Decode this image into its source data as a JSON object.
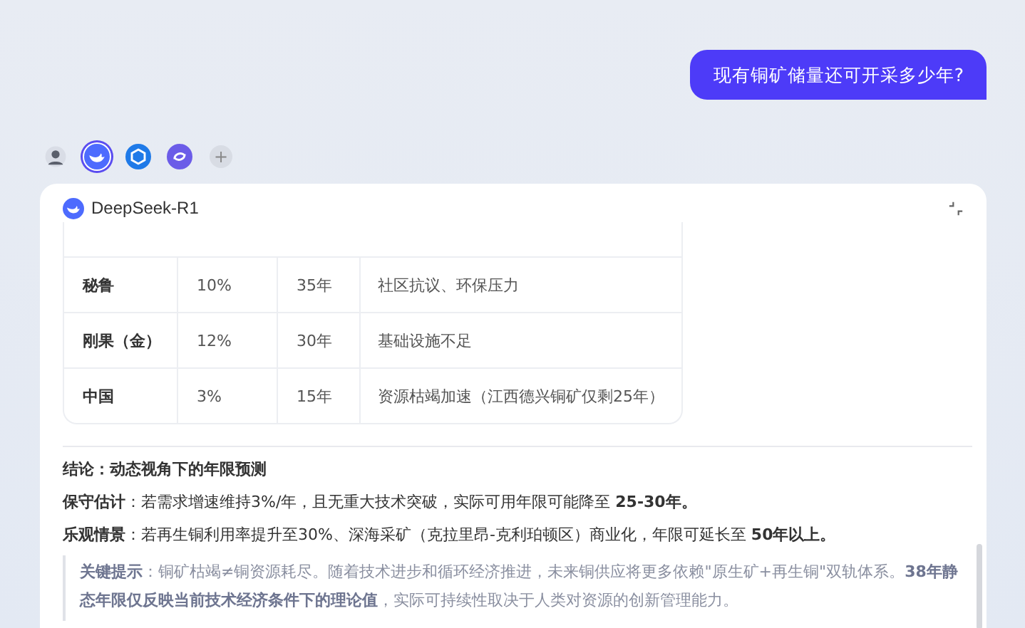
{
  "user_message": "现有铜矿储量还可开采多少年?",
  "models": [
    {
      "kind": "avatar",
      "selected": false
    },
    {
      "kind": "whale",
      "selected": true
    },
    {
      "kind": "cube",
      "selected": false
    },
    {
      "kind": "swirl",
      "selected": false
    },
    {
      "kind": "add",
      "label": "+",
      "selected": false
    }
  ],
  "answer": {
    "model_name": "DeepSeek-R1",
    "table": {
      "rows": [
        {
          "cells": [
            "秘鲁",
            "10%",
            "35年",
            "社区抗议、环保压力"
          ]
        },
        {
          "cells": [
            "刚果（金）",
            "12%",
            "30年",
            "基础设施不足"
          ]
        },
        {
          "cells": [
            "中国",
            "3%",
            "15年",
            "资源枯竭加速（江西德兴铜矿仅剩25年）"
          ]
        }
      ]
    },
    "conclusion_title": "结论：动态视角下的年限预测",
    "paragraphs": [
      "**保守估计**：若需求增速维持3%/年，且无重大技术突破，实际可用年限可能降至 **25-30年。**",
      "**乐观情景**：若再生铜利用率提升至30%、深海采矿（克拉里昂-克利珀顿区）商业化，年限可延长至 **50年以上。**"
    ],
    "note": "**关键提示**：铜矿枯竭≠铜资源耗尽。随着技术进步和循环经济推进，未来铜供应将更多依赖\"原生矿+再生铜\"双轨体系。**38年静态年限仅反映当前技术经济条件下的理论值**，实际可持续性取决于人类对资源的创新管理能力。"
  }
}
